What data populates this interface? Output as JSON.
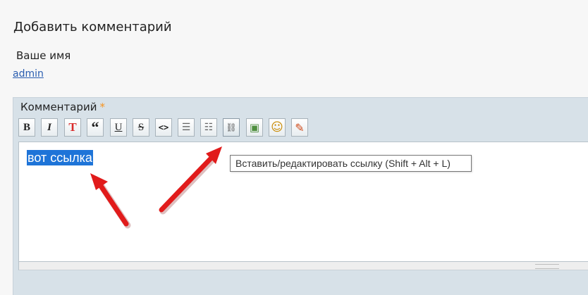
{
  "page": {
    "title": "Добавить комментарий",
    "name_label": "Ваше имя",
    "name_value": "admin"
  },
  "comment": {
    "label": "Комментарий",
    "required_mark": "*",
    "editor_text": "вот ссылка"
  },
  "toolbar": {
    "buttons": [
      {
        "icon": "bold-icon",
        "glyph": "B"
      },
      {
        "icon": "italic-icon",
        "glyph": "I"
      },
      {
        "icon": "text-color-icon",
        "glyph": "T"
      },
      {
        "icon": "quote-icon",
        "glyph": "“"
      },
      {
        "icon": "underline-icon",
        "glyph": "U"
      },
      {
        "icon": "strikethrough-icon",
        "glyph": "S"
      },
      {
        "icon": "code-icon",
        "glyph": "<>"
      },
      {
        "icon": "ordered-list-icon",
        "glyph": "☰"
      },
      {
        "icon": "unordered-list-icon",
        "glyph": "☷"
      },
      {
        "icon": "link-icon",
        "glyph": "⛓"
      },
      {
        "icon": "image-icon",
        "glyph": "▣"
      },
      {
        "icon": "emoji-icon",
        "glyph": "☺"
      },
      {
        "icon": "edit-icon",
        "glyph": "✎"
      }
    ]
  },
  "tooltip": {
    "text": "Вставить/редактировать ссылку (Shift + Alt + L)"
  },
  "colors": {
    "panel_bg": "#d7e1e8",
    "selection": "#1e74d8",
    "arrow_red": "#e11b1b",
    "required_star": "#f7931e"
  }
}
